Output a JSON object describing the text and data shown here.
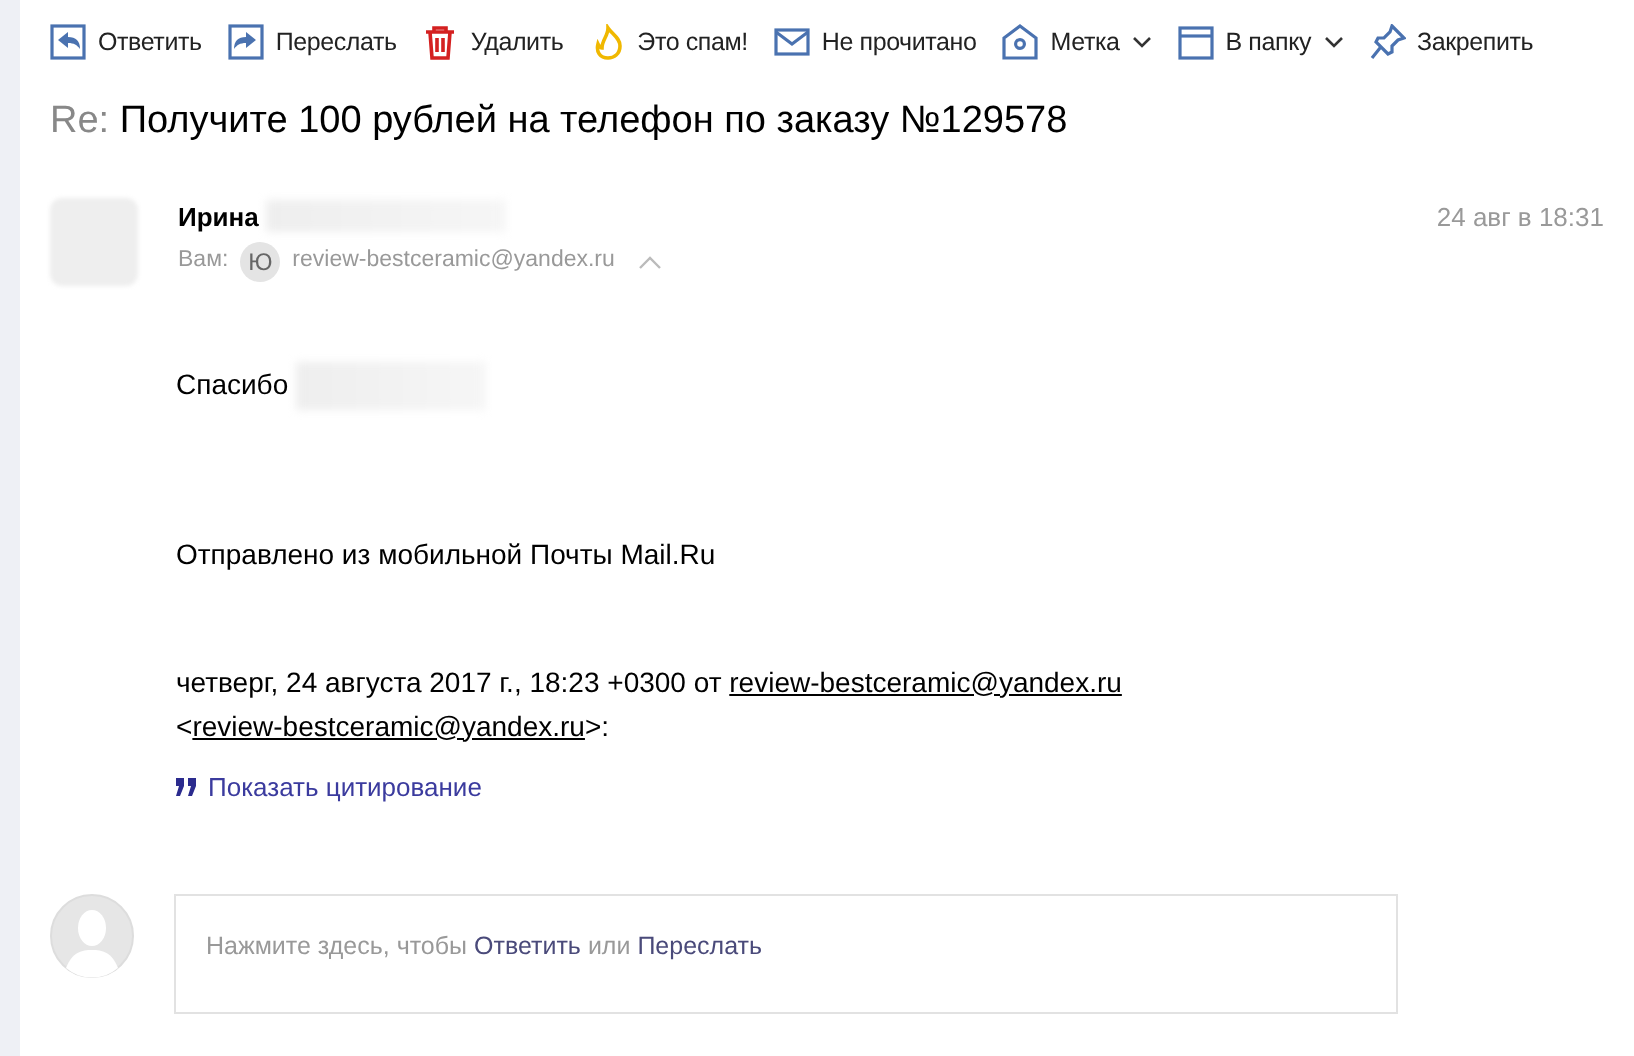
{
  "toolbar": [
    {
      "label": "Ответить",
      "kind": "reply"
    },
    {
      "label": "Переслать",
      "kind": "forward"
    },
    {
      "label": "Удалить",
      "kind": "delete"
    },
    {
      "label": "Это спам!",
      "kind": "spam"
    },
    {
      "label": "Не прочитано",
      "kind": "unread"
    },
    {
      "label": "Метка",
      "kind": "label",
      "dropdown": true
    },
    {
      "label": "В папку",
      "kind": "folder",
      "dropdown": true
    },
    {
      "label": "Закрепить",
      "kind": "pin"
    }
  ],
  "subject": {
    "prefix": "Re:",
    "text": "Получите 100 рублей на телефон по заказу №129578"
  },
  "header": {
    "sender": "Ирина",
    "to_label": "Вам:",
    "avatar_letter": "Ю",
    "to_email": "review-bestceramic@yandex.ru",
    "date": "24 авг в 18:31"
  },
  "body": {
    "greeting": "Спасибо",
    "signature": "Отправлено из мобильной Почты Mail.Ru",
    "quote_intro": "четверг, 24 августа 2017 г., 18:23 +0300 от",
    "quote_link_1": "review-bestceramic@yandex.ru",
    "quote_open": "<",
    "quote_link_2": "review-bestceramic@yandex.ru",
    "quote_close": ">:",
    "show_quote": "Показать цитирование"
  },
  "reply_box": {
    "prompt": "Нажмите здесь, чтобы",
    "reply": "Ответить",
    "or": "или",
    "forward": "Переслать"
  }
}
